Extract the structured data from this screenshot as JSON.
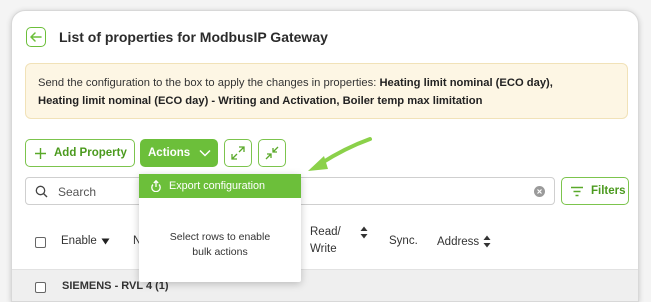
{
  "header": {
    "title": "List of properties for ModbusIP Gateway"
  },
  "notice": {
    "prefix": "Send the configuration to the box to apply the changes in properties: ",
    "line1_bold": "Heating limit nominal (ECO day),",
    "line2_bold": "Heating limit nominal (ECO day) - Writing and Activation, Boiler temp max limitation"
  },
  "toolbar": {
    "add_property_label": "Add Property",
    "actions_label": "Actions",
    "filters_label": "Filters"
  },
  "search": {
    "placeholder": "Search"
  },
  "actions_menu": {
    "items": [
      {
        "label": "Export configuration",
        "icon": "export-icon"
      }
    ],
    "hint": "Select rows to enable bulk actions"
  },
  "table": {
    "columns": {
      "enable": "Enable",
      "name_partial": "N",
      "read_write_1": "Read/",
      "read_write_2": "Write",
      "sync": "Sync.",
      "address": "Address"
    },
    "group_row": "SIEMENS - RVL 4 (1)"
  },
  "colors": {
    "accent": "#6cbf3a",
    "notice_bg": "#fdf6e4"
  }
}
